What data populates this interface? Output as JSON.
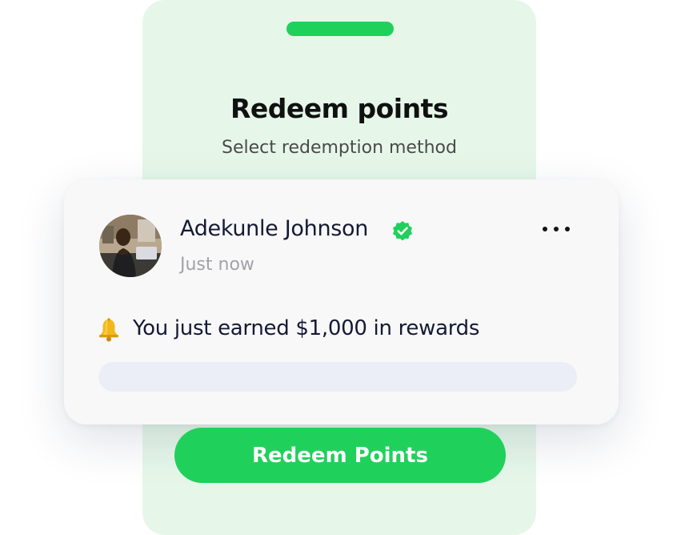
{
  "screen": {
    "title": "Redeem points",
    "subtitle": "Select redemption method"
  },
  "notification": {
    "user_name": "Adekunle Johnson",
    "verified": true,
    "timestamp": "Just now",
    "more_icon": "more-horizontal-icon",
    "bell_icon": "bell-icon",
    "message": "You just earned $1,000 in rewards",
    "progress": 0
  },
  "actions": {
    "redeem_label": "Redeem Points"
  },
  "colors": {
    "accent": "#1fd15a",
    "phone_background": "#e6f7ea",
    "card_background": "#f8f8f9",
    "text_primary": "#141a33",
    "text_muted": "#a2a2a8",
    "progress_track": "#ebeef6"
  }
}
